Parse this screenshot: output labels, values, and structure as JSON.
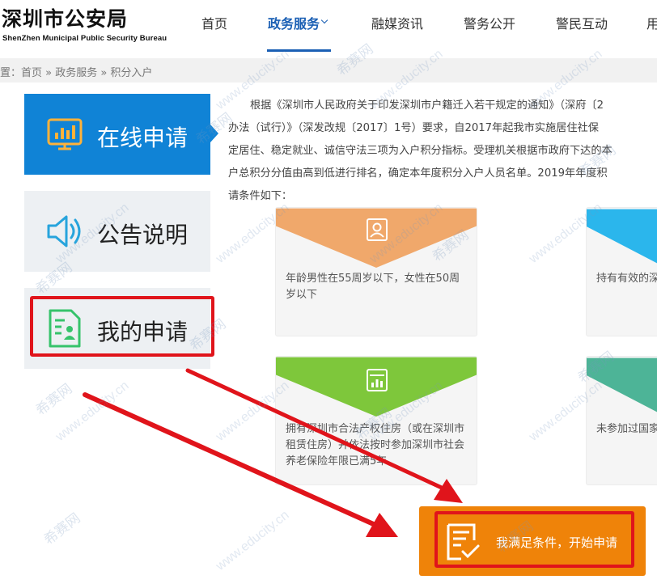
{
  "header": {
    "logo_cn": "深圳市公安局",
    "logo_en": "ShenZhen Municipal Public Security Bureau",
    "nav": [
      "首页",
      "政务服务",
      "融媒资讯",
      "警务公开",
      "警民互动",
      "用"
    ],
    "active_nav": "政务服务"
  },
  "breadcrumb": "置：首页 » 政务服务 » 积分入户",
  "menu": {
    "apply": "在线申请",
    "notice": "公告说明",
    "mine": "我的申请"
  },
  "intro": [
    "根据《深圳市人民政府关于印发深圳市户籍迁入若干规定的通知》（深府〔2",
    "办法（试行）》（深发改规〔2017〕1号）要求，自2017年起我市实施居住社保",
    "定居住、稳定就业、诚信守法三项为入户积分指标。受理机关根据市政府下达的本",
    "户总积分分值由高到低进行排名，确定本年度积分入户人员名单。2019年年度积",
    "请条件如下："
  ],
  "conditions": [
    {
      "text": "年龄男性在55周岁以下，女性在50周岁以下",
      "color": "#f0a86b",
      "icon": "person-card-icon"
    },
    {
      "text": "持有有效的深",
      "color": "#2bb6ec",
      "icon": "card-icon"
    },
    {
      "text": "拥有深圳市合法产权住房（或在深圳市租赁住房）并依法按时参加深圳市社会养老保险年限已满5年",
      "color": "#7ec73b",
      "icon": "bar-chart-icon"
    },
    {
      "text": "未参加过国家",
      "color": "#4db497",
      "icon": "shield-icon"
    }
  ],
  "apply_button": "我满足条件，开始申请",
  "watermarks": [
    "www.educity.cn",
    "希赛网"
  ],
  "colors": {
    "brand_blue": "#1a5fb4",
    "menu_blue": "#1083d6",
    "apply_orange": "#ef8309",
    "highlight_red": "#e0141b"
  }
}
